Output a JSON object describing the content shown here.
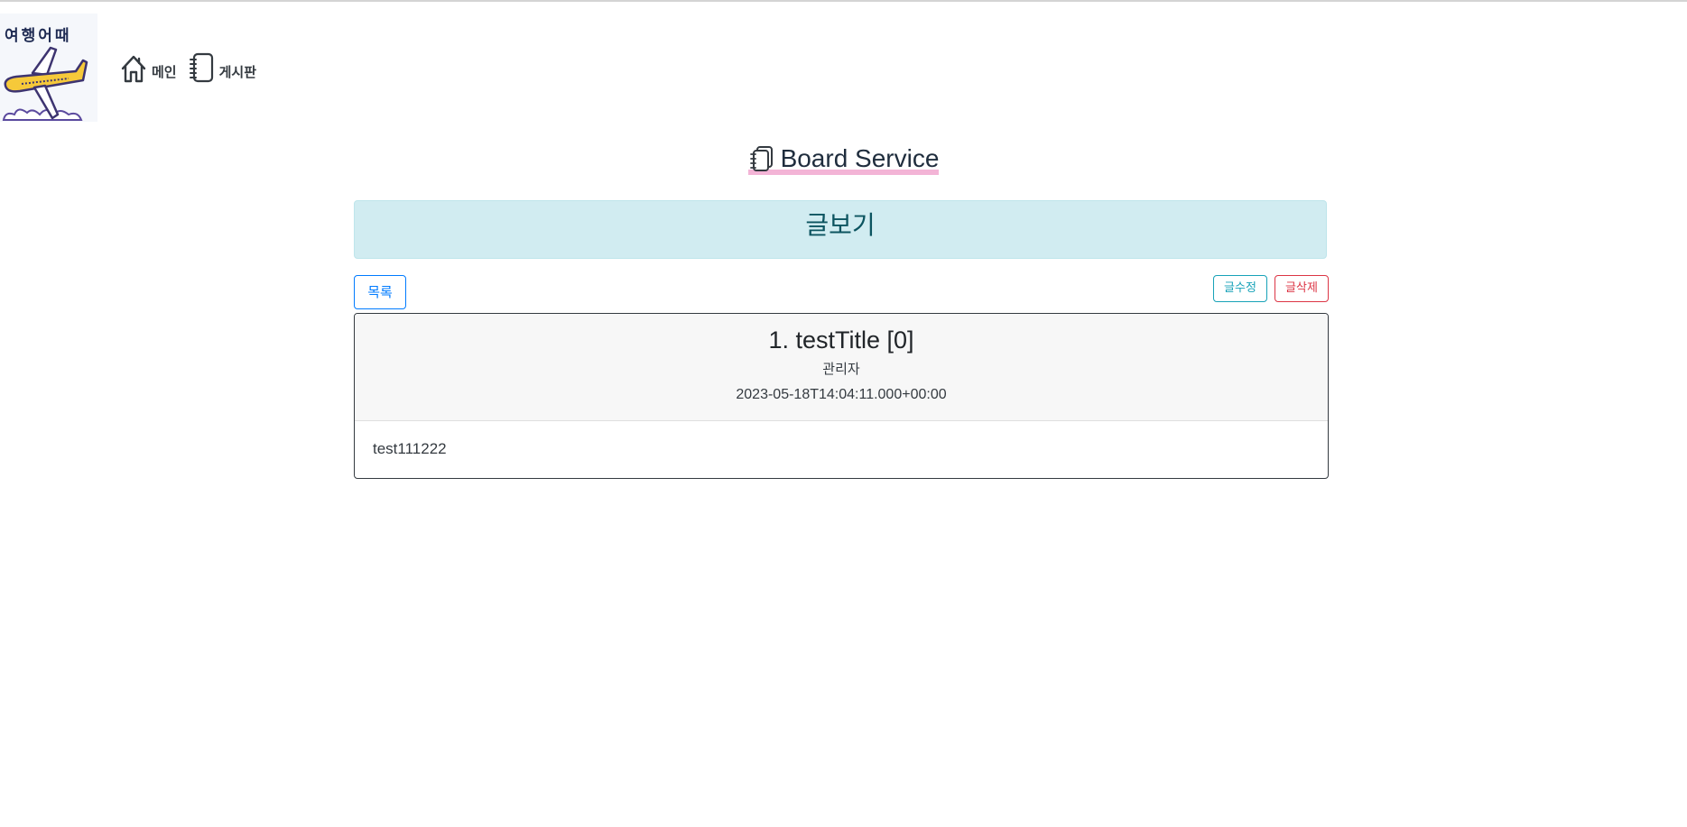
{
  "logo": {
    "text": "여행어때"
  },
  "nav": {
    "main_label": "메인",
    "board_label": "게시판"
  },
  "service": {
    "title": "Board Service"
  },
  "page": {
    "heading": "글보기"
  },
  "actions": {
    "list_label": "목록",
    "edit_label": "글수정",
    "delete_label": "글삭제"
  },
  "post": {
    "title": "1. testTitle [0]",
    "author": "관리자",
    "date": "2023-05-18T14:04:11.000+00:00",
    "content": "test111222"
  },
  "icons": {
    "home": "house-icon",
    "board": "notebook-icon",
    "service": "stacked-notebooks-icon"
  },
  "colors": {
    "primary": "#007bff",
    "info": "#17a2b8",
    "danger": "#dc3545",
    "alert_bg": "#d1ecf1",
    "alert_text": "#0c5460",
    "highlight": "#f3b4d6"
  }
}
